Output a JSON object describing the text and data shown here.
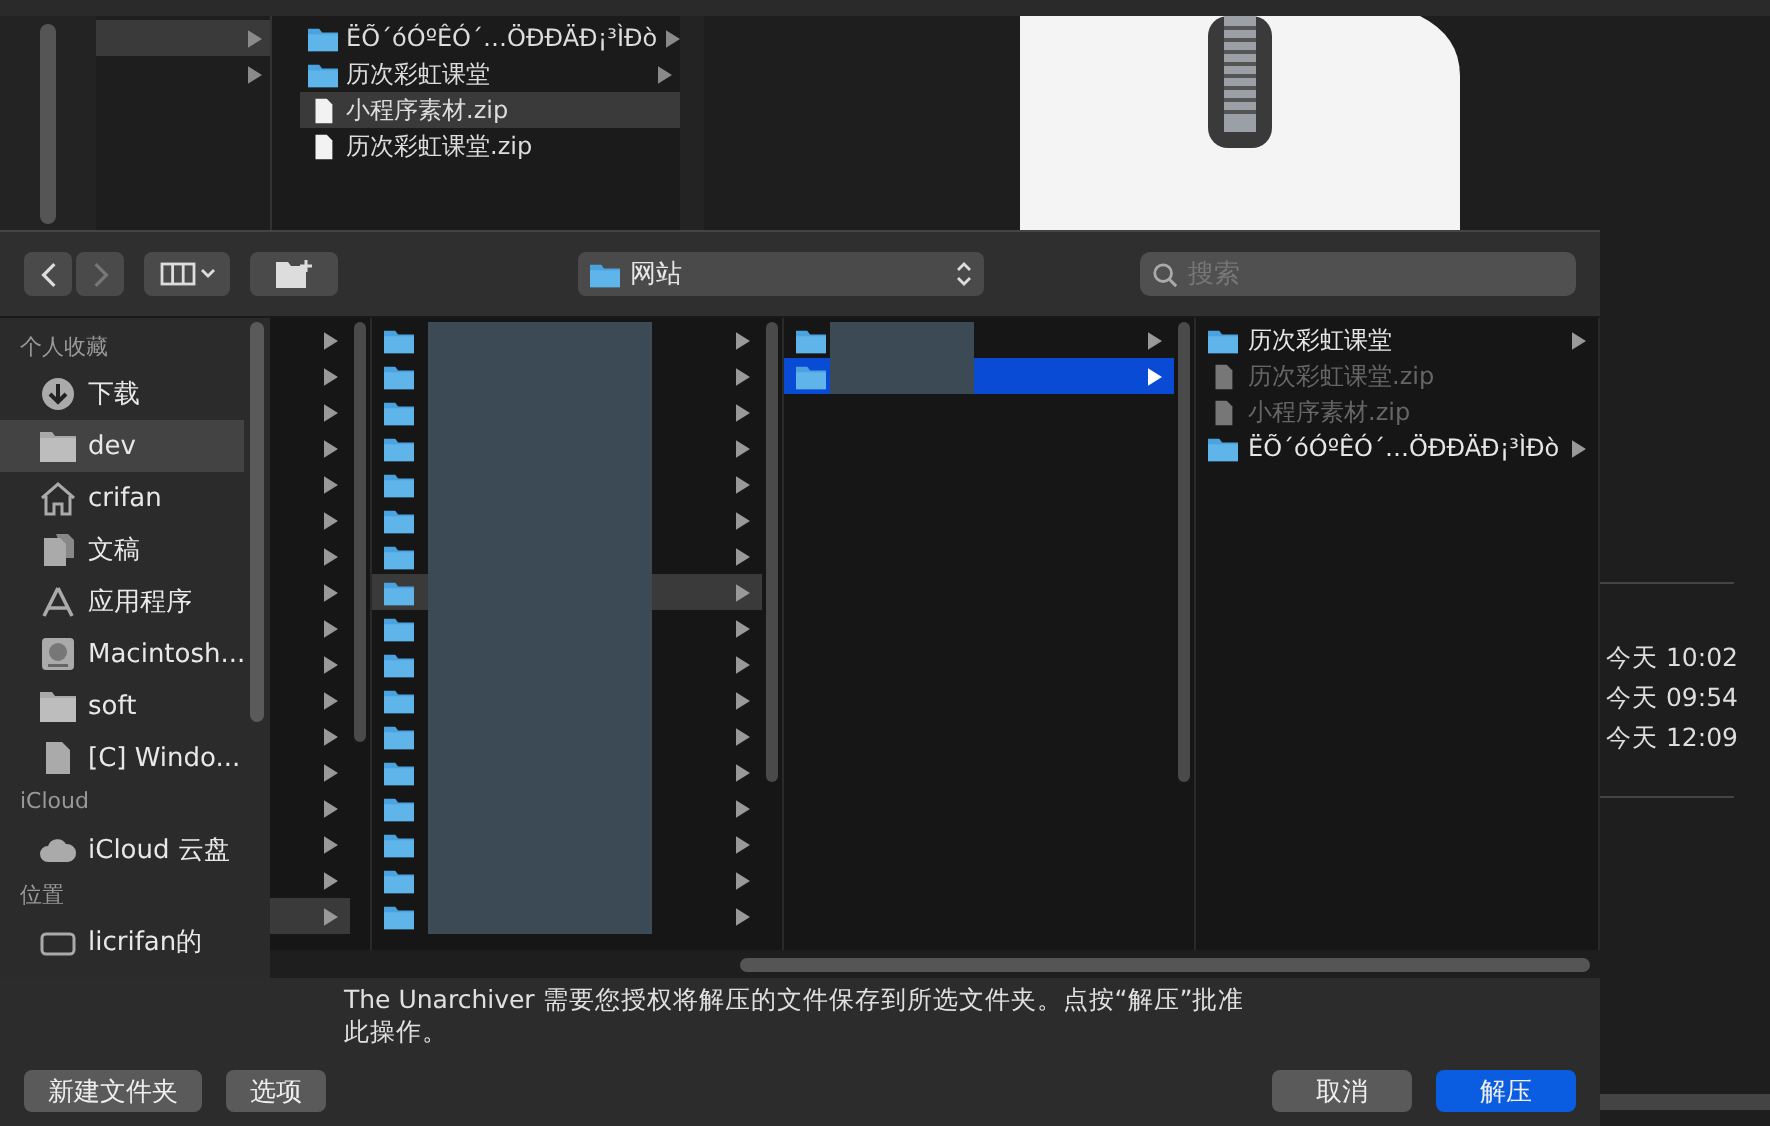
{
  "background": {
    "left_column": [
      {
        "selected": true,
        "has_children": true
      },
      {
        "selected": false,
        "has_children": true
      }
    ],
    "file_column": [
      {
        "name": "ËÕ´óÓºÊÓ´…ÖÐÐÄÐ¡³ÌÐò",
        "kind": "folder",
        "selected": false,
        "has_children": true
      },
      {
        "name": "历次彩虹课堂",
        "kind": "folder",
        "selected": false,
        "has_children": true
      },
      {
        "name": "小程序素材.zip",
        "kind": "file",
        "selected": true,
        "has_children": false
      },
      {
        "name": "历次彩虹课堂.zip",
        "kind": "file",
        "selected": false,
        "has_children": false
      }
    ],
    "dates": [
      "今天 10:02",
      "今天 09:54",
      "今天 12:09"
    ]
  },
  "dialog": {
    "toolbar": {
      "path": "网站",
      "search": {
        "placeholder": "搜索"
      }
    },
    "sidebar": [
      {
        "title": "个人收藏",
        "items": [
          {
            "label": "下载",
            "kind": "download",
            "selected": false
          },
          {
            "label": "dev",
            "kind": "folder",
            "selected": true
          },
          {
            "label": "crifan",
            "kind": "home",
            "selected": false
          },
          {
            "label": "文稿",
            "kind": "documents",
            "selected": false
          },
          {
            "label": "应用程序",
            "kind": "apps",
            "selected": false
          },
          {
            "label": "Macintosh...",
            "kind": "disk",
            "selected": false
          },
          {
            "label": "soft",
            "kind": "folder",
            "selected": false
          },
          {
            "label": "[C] Windo...",
            "kind": "file",
            "selected": false
          }
        ]
      },
      {
        "title": "iCloud",
        "items": [
          {
            "label": "iCloud 云盘",
            "kind": "cloud",
            "selected": false
          }
        ]
      },
      {
        "title": "位置",
        "items": [
          {
            "label": "licrifan的",
            "kind": "drive",
            "selected": false
          }
        ]
      }
    ],
    "columns": [
      {
        "kind": "arrows",
        "rows": [
          {
            "selected": false
          },
          {
            "selected": false
          },
          {
            "selected": false
          },
          {
            "selected": false
          },
          {
            "selected": false
          },
          {
            "selected": false
          },
          {
            "selected": false
          },
          {
            "selected": false
          },
          {
            "selected": false
          },
          {
            "selected": false
          },
          {
            "selected": false
          },
          {
            "selected": false
          },
          {
            "selected": false
          },
          {
            "selected": false
          },
          {
            "selected": false
          },
          {
            "selected": false
          },
          {
            "selected": true
          }
        ]
      },
      {
        "kind": "redacted",
        "rows": [
          {
            "selected": false
          },
          {
            "selected": false
          },
          {
            "selected": false
          },
          {
            "selected": false
          },
          {
            "selected": false
          },
          {
            "selected": false
          },
          {
            "selected": false
          },
          {
            "selected": true
          },
          {
            "selected": false
          },
          {
            "selected": false
          },
          {
            "selected": false
          },
          {
            "selected": false
          },
          {
            "selected": false
          },
          {
            "selected": false
          },
          {
            "selected": false
          },
          {
            "selected": false
          },
          {
            "selected": false
          }
        ]
      },
      {
        "kind": "redacted",
        "rows": [
          {
            "selected": false
          },
          {
            "selected": true
          }
        ]
      },
      {
        "kind": "files",
        "rows": [
          {
            "name": "历次彩虹课堂",
            "kind": "folder",
            "selected": false,
            "disabled": false,
            "has_children": true
          },
          {
            "name": "历次彩虹课堂.zip",
            "kind": "file",
            "selected": false,
            "disabled": true,
            "has_children": false
          },
          {
            "name": "小程序素材.zip",
            "kind": "file",
            "selected": false,
            "disabled": true,
            "has_children": false
          },
          {
            "name": "ËÕ´óÓºÊÓ´…ÖÐÐÄÐ¡³ÌÐò",
            "kind": "folder",
            "selected": false,
            "disabled": false,
            "has_children": true
          }
        ]
      }
    ],
    "message": "The Unarchiver 需要您授权将解压的文件保存到所选文件夹。点按“解压”批准此操作。",
    "buttons_left": [
      {
        "label": "新建文件夹",
        "default": false
      },
      {
        "label": "选项",
        "default": false
      }
    ],
    "buttons_right": [
      {
        "label": "取消",
        "default": false
      },
      {
        "label": "解压",
        "default": true
      }
    ]
  }
}
